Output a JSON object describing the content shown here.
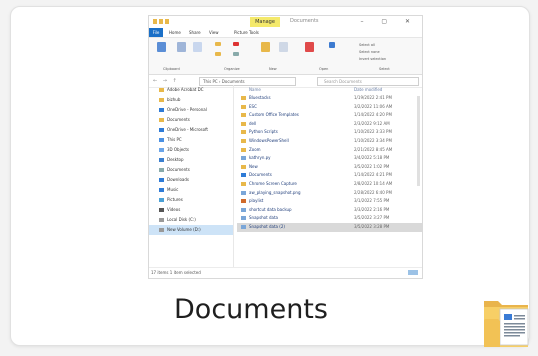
{
  "card": {
    "label": "Documents"
  },
  "thumbnail": {
    "window_title": "Documents",
    "tab_manage": "Manage",
    "window_buttons": "– ▢ ✕",
    "menu": [
      "File",
      "Home",
      "Share",
      "View",
      "Picture Tools"
    ],
    "ribbon_groups": [
      "Clipboard",
      "Organize",
      "New",
      "Open",
      "Select"
    ],
    "ribbon_items": [
      "Pin to Quick access",
      "Copy",
      "Paste",
      "Move to",
      "Delete",
      "Copy to",
      "Rename",
      "New folder",
      "Properties",
      "Select all",
      "Select none",
      "Invert selection"
    ],
    "address": "This PC › Documents",
    "search_placeholder": "Search Documents",
    "nav_items": [
      "Adobe Acrobat DC",
      "bizhub",
      "OneDrive - Personal",
      "Documents",
      "OneDrive - Microsoft",
      "This PC",
      "3D Objects",
      "Desktop",
      "Documents",
      "Downloads",
      "Music",
      "Pictures",
      "Videos",
      "Local Disk (C:)",
      "New Volume (D:)"
    ],
    "column_headers": [
      "Name",
      "Date modified"
    ],
    "files": [
      "Bluestacks",
      "ESC",
      "Custom Office Templates",
      "dell",
      "Python Scripts",
      "WindowsPowerShell",
      "Zoom",
      "kathryn.py",
      "New",
      "Documents",
      "Chrome Screen Capture",
      "aw_playing_snapshot.png",
      "playlist",
      "shortcut data backup",
      "Snapshot data",
      "Snapshot data (2)"
    ],
    "dates": [
      "1/19/2022 2:41 PM",
      "3/2/2022 11:06 AM",
      "1/14/2022 4:20 PM",
      "2/3/2022 9:12 AM",
      "1/10/2022 3:33 PM",
      "1/10/2022 3:34 PM",
      "2/21/2022 8:45 AM",
      "3/4/2022 5:18 PM",
      "3/5/2022 1:02 PM",
      "1/14/2022 4:21 PM",
      "2/8/2022 10:14 AM",
      "2/28/2022 6:40 PM",
      "3/1/2022 7:55 PM",
      "3/3/2022 2:16 PM",
      "3/5/2022 3:27 PM",
      "3/5/2022 3:28 PM"
    ],
    "status": "17 items   1 item selected"
  },
  "colors": {
    "accent": "#1a6fc7",
    "folder": "#e8b84a",
    "manage_tab": "#f4e96b"
  }
}
